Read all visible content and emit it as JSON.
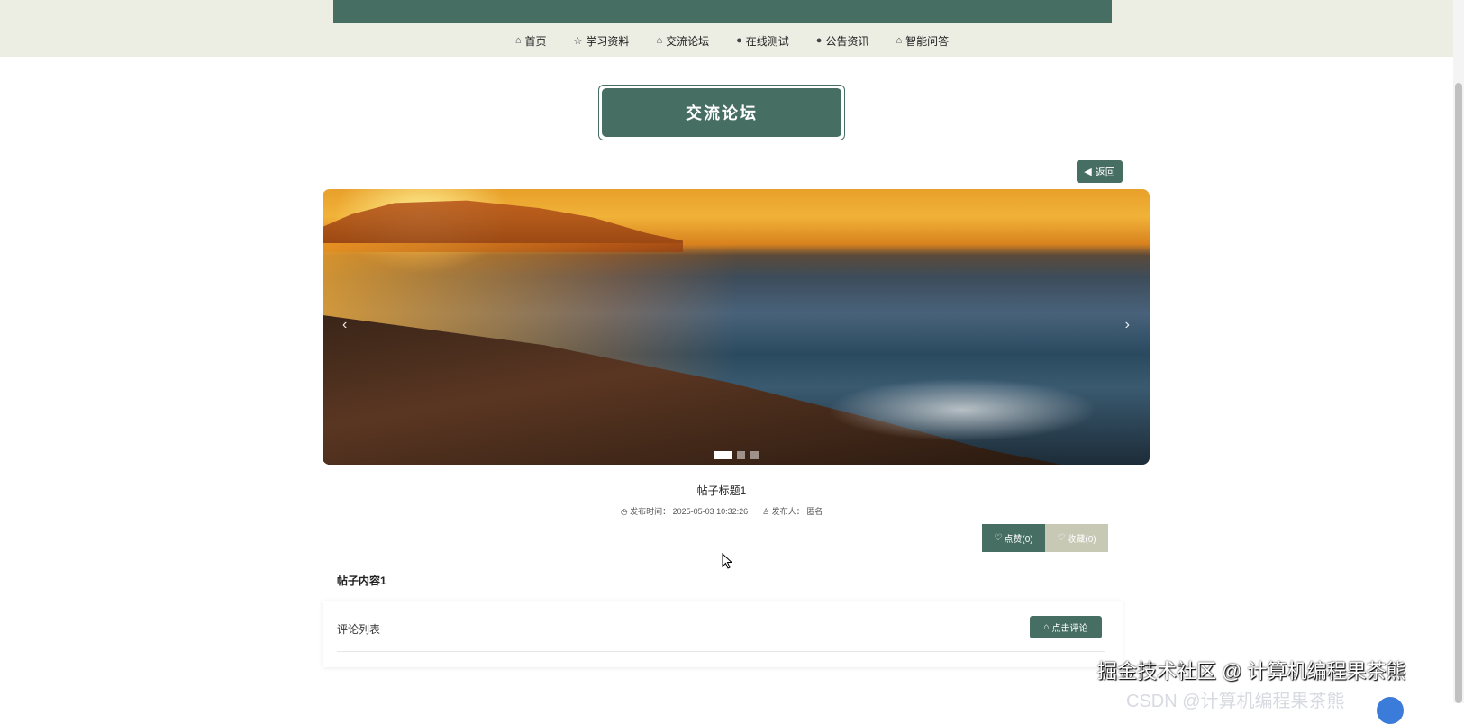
{
  "nav": {
    "items": [
      {
        "label": "首页",
        "icon": "⌂"
      },
      {
        "label": "学习资料",
        "icon": "☆"
      },
      {
        "label": "交流论坛",
        "icon": "⌂"
      },
      {
        "label": "在线测试",
        "icon": "●"
      },
      {
        "label": "公告资讯",
        "icon": "●"
      },
      {
        "label": "智能问答",
        "icon": "⌂"
      }
    ]
  },
  "page": {
    "section_title": "交流论坛",
    "back_label": "返回",
    "back_icon": "◀"
  },
  "carousel": {
    "prev": "‹",
    "next": "›",
    "slide_count": 3,
    "active_index": 0
  },
  "post": {
    "title": "帖子标题1",
    "time_label": "发布时间：",
    "time_value": "2025-05-03 10:32:26",
    "author_label": "发布人：",
    "author_value": "匿名",
    "like_label": "点赞(0)",
    "fav_label": "收藏(0)",
    "content": "帖子内容1"
  },
  "comments": {
    "label": "评论列表",
    "button_label": "点击评论"
  },
  "watermark": {
    "text": "掘金技术社区 @ 计算机编程果茶熊",
    "ghost": "CSDN @计算机编程果茶熊"
  },
  "colors": {
    "primary": "#476e62",
    "header_bg": "#eceee4",
    "fav_bg": "#c7c9b5"
  }
}
